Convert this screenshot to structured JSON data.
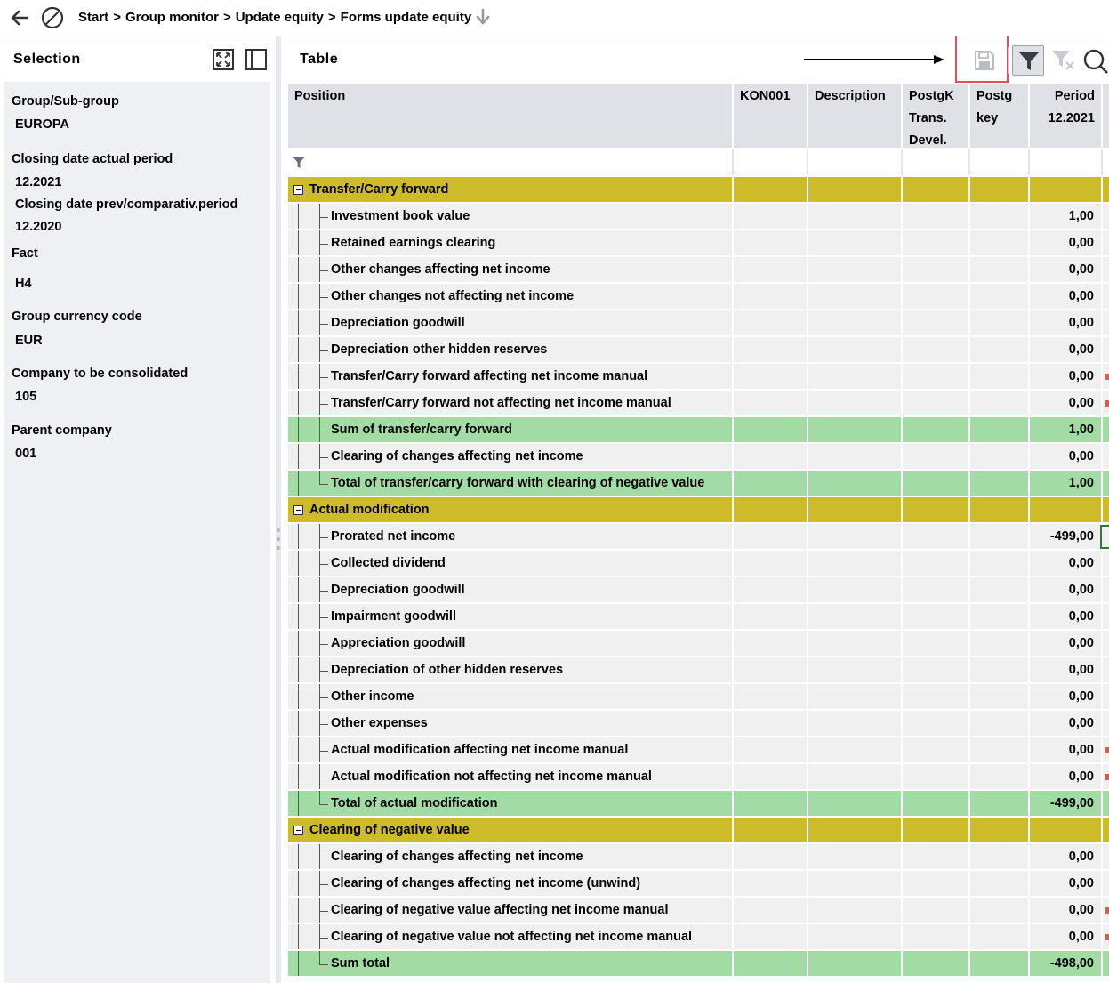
{
  "breadcrumb": {
    "items": [
      "Start",
      "Group monitor",
      "Update equity",
      "Forms update equity"
    ],
    "separator": ">"
  },
  "selection_panel": {
    "title": "Selection",
    "fields": [
      {
        "label": "Group/Sub-group",
        "value": "EUROPA"
      },
      {
        "label": "Closing date actual period",
        "value": "12.2021"
      },
      {
        "label": "Closing date prev/comparativ.period",
        "value": "12.2020"
      },
      {
        "label": "Fact",
        "value": "H4"
      },
      {
        "label": "Group currency code",
        "value": "EUR"
      },
      {
        "label": "Company to be consolidated",
        "value": "105"
      },
      {
        "label": "Parent company",
        "value": "001"
      }
    ]
  },
  "table_panel": {
    "title": "Table",
    "columns": [
      {
        "lines": [
          "Position"
        ]
      },
      {
        "lines": [
          "KON001"
        ]
      },
      {
        "lines": [
          "Description"
        ]
      },
      {
        "lines": [
          "PostgK",
          "Trans.",
          "Devel."
        ]
      },
      {
        "lines": [
          "Postg",
          "key"
        ]
      },
      {
        "lines": [
          "Period",
          "12.2021"
        ]
      }
    ],
    "rows": [
      {
        "type": "group",
        "label": "Transfer/Carry forward",
        "value": ""
      },
      {
        "type": "item",
        "label": "Investment book value",
        "value": "1,00"
      },
      {
        "type": "item",
        "label": "Retained earnings clearing",
        "value": "0,00"
      },
      {
        "type": "item",
        "label": "Other changes affecting net income",
        "value": "0,00"
      },
      {
        "type": "item",
        "label": "Other changes not affecting net income",
        "value": "0,00"
      },
      {
        "type": "item",
        "label": "Depreciation goodwill",
        "value": "0,00"
      },
      {
        "type": "item",
        "label": "Depreciation other hidden reserves",
        "value": "0,00"
      },
      {
        "type": "item",
        "label": "Transfer/Carry forward affecting net income manual",
        "value": "0,00"
      },
      {
        "type": "item",
        "label": "Transfer/Carry forward not affecting net income manual",
        "value": "0,00"
      },
      {
        "type": "sum",
        "label": "Sum of transfer/carry forward",
        "value": "1,00"
      },
      {
        "type": "item",
        "label": "Clearing of changes affecting net income",
        "value": "0,00"
      },
      {
        "type": "sum",
        "label": "Total of transfer/carry forward with clearing of negative value",
        "value": "1,00",
        "last": true
      },
      {
        "type": "group",
        "label": "Actual modification",
        "value": ""
      },
      {
        "type": "item",
        "label": "Prorated net income",
        "value": "-499,00"
      },
      {
        "type": "item",
        "label": "Collected dividend",
        "value": "0,00"
      },
      {
        "type": "item",
        "label": "Depreciation goodwill",
        "value": "0,00"
      },
      {
        "type": "item",
        "label": "Impairment goodwill",
        "value": "0,00"
      },
      {
        "type": "item",
        "label": "Appreciation goodwill",
        "value": "0,00"
      },
      {
        "type": "item",
        "label": "Depreciation  of other hidden reserves",
        "value": "0,00"
      },
      {
        "type": "item",
        "label": "Other income",
        "value": "0,00"
      },
      {
        "type": "item",
        "label": "Other expenses",
        "value": "0,00"
      },
      {
        "type": "item",
        "label": "Actual modification affecting net income manual",
        "value": "0,00"
      },
      {
        "type": "item",
        "label": "Actual modification not affecting net income manual",
        "value": "0,00"
      },
      {
        "type": "sum",
        "label": "Total of actual modification",
        "value": "-499,00",
        "last": true
      },
      {
        "type": "group",
        "label": "Clearing of negative value",
        "value": ""
      },
      {
        "type": "item",
        "label": "Clearing of changes affecting net income",
        "value": "0,00"
      },
      {
        "type": "item",
        "label": "Clearing of changes affecting net income (unwind)",
        "value": "0,00"
      },
      {
        "type": "item",
        "label": "Clearing of negative value affecting net income manual",
        "value": "0,00"
      },
      {
        "type": "item",
        "label": "Clearing of negative value not affecting net income manual",
        "value": "0,00"
      },
      {
        "type": "sum",
        "label": "Sum total",
        "value": "-498,00",
        "last": true
      }
    ],
    "toolbar_icons": [
      "save-icon",
      "filter-icon",
      "clear-filter-icon",
      "search-icon"
    ]
  },
  "colors": {
    "group_row": "#cdbb2a",
    "item_row": "#f0f0f0",
    "sum_row": "#a2dca4",
    "header_bg": "#dfe1e7",
    "highlight_box": "#e05151"
  }
}
